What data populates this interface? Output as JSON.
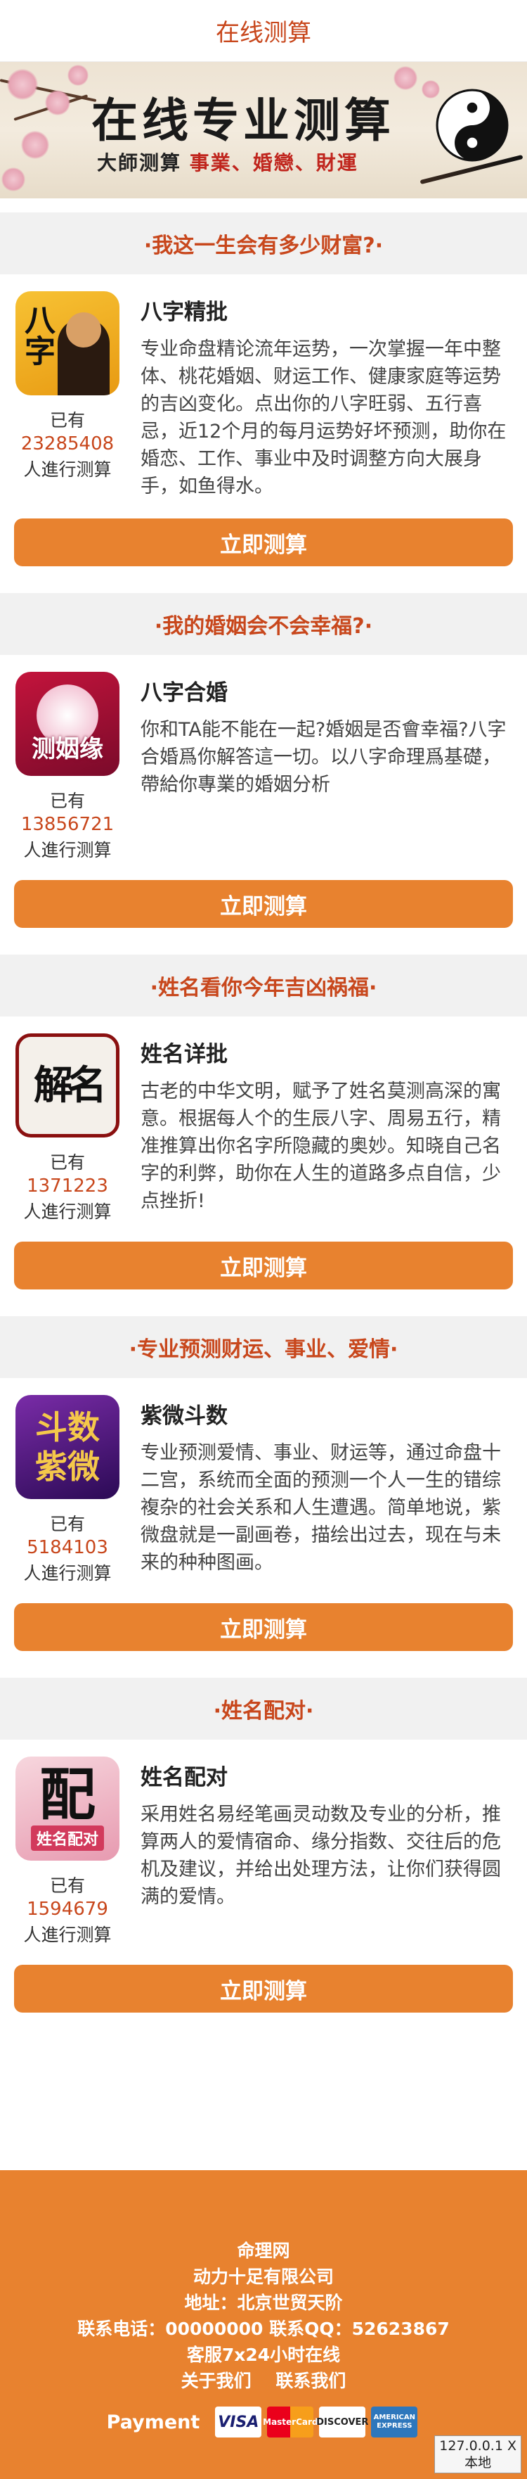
{
  "header": {
    "title": "在线测算"
  },
  "banner": {
    "title": "在线专业测算",
    "subtitle_dark": "大師测算",
    "subtitle_red": "事業、婚戀、財運"
  },
  "common": {
    "count_prefix": "已有",
    "count_suffix": "人進行测算",
    "button_label": "立即测算"
  },
  "sections": [
    {
      "heading": "·我这一生会有多少财富?·",
      "icon_text": "八字",
      "title": "八字精批",
      "count": "23285408",
      "description": "专业命盘精论流年运势，一次掌握一年中整体、桃花婚姻、财运工作、健康家庭等运势的吉凶变化。点出你的八字旺弱、五行喜忌，近12个月的每月运势好坏预测，助你在婚恋、工作、事业中及时调整方向大展身手，如鱼得水。"
    },
    {
      "heading": "·我的婚姻会不会幸福?·",
      "icon_text": "测姻缘",
      "title": "八字合婚",
      "count": "13856721",
      "description": "你和TA能不能在一起?婚姻是否會幸福?八字合婚爲你解答這一切。以八字命理爲基礎，帶給你專業的婚姻分析"
    },
    {
      "heading": "·姓名看你今年吉凶祸福·",
      "icon_text": "解名",
      "title": "姓名详批",
      "count": "1371223",
      "description": "古老的中华文明，赋予了姓名莫测高深的寓意。根据每人个的生辰八字、周易五行，精准推算出你名字所隐藏的奥妙。知晓自己名字的利弊，助你在人生的道路多点自信，少点挫折!"
    },
    {
      "heading": "·专业预测财运、事业、爱情·",
      "icon_text": "斗数紫微",
      "title": "紫微斗数",
      "count": "5184103",
      "description": "专业预测爱情、事业、财运等，通过命盘十二宫，系统而全面的预测一个人一生的错综複杂的社会关系和人生遭遇。简单地说，紫微盘就是一副画卷，描绘出过去，现在与未来的种种图画。"
    },
    {
      "heading": "·姓名配对·",
      "icon_text": "配",
      "icon_sub": "姓名配对",
      "title": "姓名配对",
      "count": "1594679",
      "description": "采用姓名易经笔画灵动数及专业的分析，推算两人的爱情宿命、缘分指数、交往后的危机及建议，并给出处理方法，让你们获得圆满的爱情。"
    }
  ],
  "footer": {
    "site": "命理网",
    "company": "动力十足有限公司",
    "address": "地址：北京世贸天阶",
    "contact": "联系电话：00000000 联系QQ：52623867",
    "service": "客服7x24小时在线",
    "about": "关于我们",
    "contact_us": "联系我们",
    "payment_label": "Payment",
    "cards": [
      "VISA",
      "MasterCard",
      "DISCOVER",
      "AMERICAN EXPRESS"
    ]
  },
  "local_badge": {
    "line1": "127.0.0.1 X",
    "line2": "本地"
  },
  "colors": {
    "accent": "#e8822f",
    "heading": "#c8471c",
    "section_bg": "#f1f1f1"
  }
}
